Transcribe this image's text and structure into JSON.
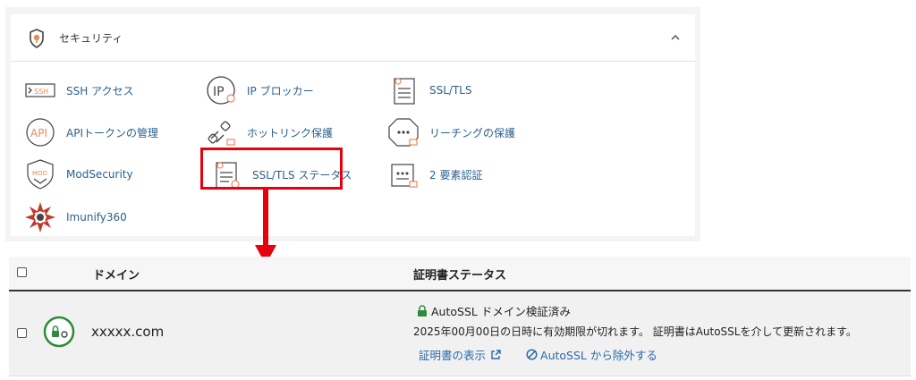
{
  "security": {
    "title": "セキュリティ",
    "tools": [
      {
        "label": "SSH アクセス",
        "icon": "ssh-icon"
      },
      {
        "label": "IP ブロッカー",
        "icon": "ip-blocker-icon"
      },
      {
        "label": "SSL/TLS",
        "icon": "ssl-tls-icon"
      },
      {
        "label": "APIトークンの管理",
        "icon": "api-icon"
      },
      {
        "label": "ホットリンク保護",
        "icon": "hotlink-icon"
      },
      {
        "label": "リーチングの保護",
        "icon": "leech-protect-icon"
      },
      {
        "label": "ModSecurity",
        "icon": "modsecurity-icon"
      },
      {
        "label": "SSL/TLS ステータス",
        "icon": "ssl-tls-status-icon"
      },
      {
        "label": "2 要素認証",
        "icon": "two-factor-icon"
      },
      {
        "label": "Imunify360",
        "icon": "imunify360-icon"
      }
    ],
    "ssh_badge": "SSH",
    "api_badge": "API",
    "ip_badge": "IP",
    "mod_badge": "MOD"
  },
  "table": {
    "col_domain": "ドメイン",
    "col_status": "証明書ステータス",
    "row": {
      "domain": "xxxxx.com",
      "status_title": "AutoSSL ドメイン検証済み",
      "status_detail": "2025年00月00日の日時に有効期限が切れます。 証明書はAutoSSLを介して更新されます。",
      "view_cert": "証明書の表示",
      "exclude": "AutoSSL から除外する"
    }
  },
  "colors": {
    "accent": "#2b5f8c",
    "highlight": "#e8000c",
    "icon_orange": "#e98a5c",
    "ok_green": "#2e8b3a"
  }
}
